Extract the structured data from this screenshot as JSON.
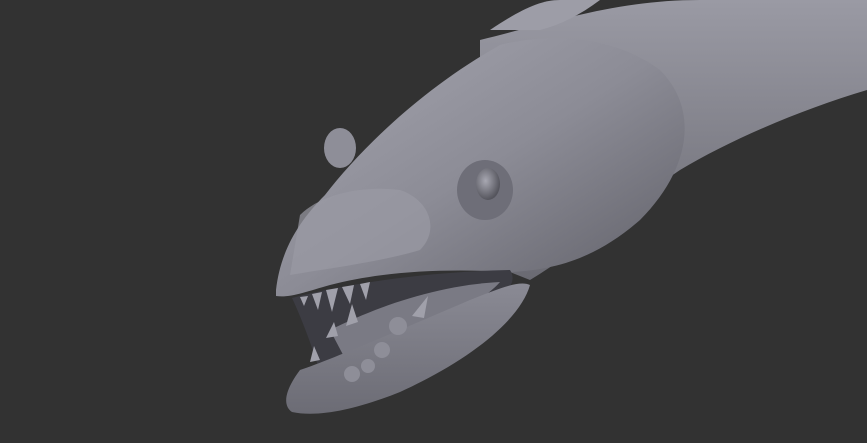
{
  "scene": {
    "subject": "sculpted-creature-head",
    "colors": {
      "background": "#323232",
      "material_light": "#a3a3ad",
      "material_mid": "#85858f",
      "material_dark": "#4a4a52",
      "mouth_interior": "#3a3a40"
    }
  }
}
